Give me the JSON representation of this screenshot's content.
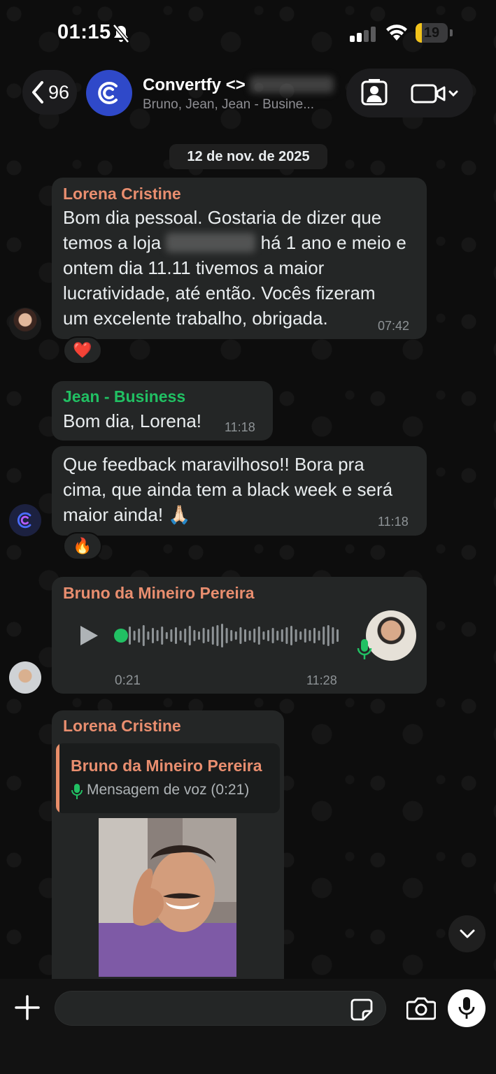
{
  "status_bar": {
    "time": "01:15",
    "battery_level": "19",
    "battery_fraction": 0.19,
    "accent_battery": "#f2c31b"
  },
  "header": {
    "back_count": "96",
    "group_name": "Convertfy <>",
    "participants": "Bruno, Jean, Jean - Busine...",
    "avatar_color": "#2f49c9",
    "icons": [
      "chevron-left-icon",
      "convertfy-logo-icon",
      "contact-card-icon",
      "video-camera-icon",
      "chevron-down-icon"
    ]
  },
  "date_separator": "12 de nov. de 2025",
  "messages": [
    {
      "sender": "Lorena Cristine",
      "sender_color": "#e98e6f",
      "lines": [
        "Bom dia pessoal. Gostaria de dizer que",
        "temos a loja",
        "há 1 ano e meio e",
        "ontem dia 11.11 tivemos a maior",
        "lucratividade, até então. Vocês fizeram",
        "um excelente trabalho, obrigada."
      ],
      "time": "07:42",
      "reaction": "❤️"
    },
    {
      "sender": "Jean - Business",
      "sender_color": "#21c063",
      "text": "Bom dia, Lorena!",
      "time": "11:18"
    },
    {
      "lines": [
        "Que feedback maravilhoso!! Bora pra",
        "cima, que ainda tem a black week e será",
        "maior ainda! 🙏🏻"
      ],
      "time": "11:18",
      "reaction": "🔥"
    },
    {
      "sender": "Bruno da Mineiro Pereira",
      "sender_color": "#e98e6f",
      "voice_duration": "0:21",
      "time": "11:28",
      "accent_voice": "#21c063"
    },
    {
      "sender": "Lorena Cristine",
      "sender_color": "#e98e6f",
      "quote_sender": "Bruno da Mineiro Pereira",
      "quote_text": "Mensagem de voz (0:21)"
    }
  ],
  "bottom_bar": {
    "icons": [
      "plus-icon",
      "sticker-icon",
      "camera-icon",
      "microphone-icon"
    ]
  }
}
